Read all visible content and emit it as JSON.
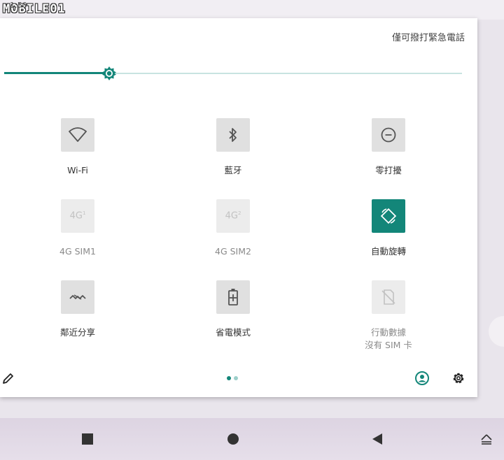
{
  "watermark": {
    "text": "MOBILE01",
    "clock_fragment": "1:50"
  },
  "panel": {
    "emergency_text": "僅可撥打緊急電話",
    "brightness": {
      "level": 0.23
    },
    "tiles": [
      {
        "label": "Wi-Fi",
        "icon": "wifi-icon",
        "state": "inactive"
      },
      {
        "label": "藍牙",
        "icon": "bluetooth-icon",
        "state": "inactive"
      },
      {
        "label": "零打擾",
        "icon": "do-not-disturb-icon",
        "state": "inactive"
      },
      {
        "label": "4G SIM1",
        "icon": "4g-sim1-icon",
        "glyph": "4G",
        "sup": "1",
        "state": "disabled"
      },
      {
        "label": "4G SIM2",
        "icon": "4g-sim2-icon",
        "glyph": "4G",
        "sup": "2",
        "state": "disabled"
      },
      {
        "label": "自動旋轉",
        "icon": "auto-rotate-icon",
        "state": "active"
      },
      {
        "label": "鄰近分享",
        "icon": "nearby-share-icon",
        "state": "inactive"
      },
      {
        "label": "省電模式",
        "icon": "battery-saver-icon",
        "state": "inactive"
      },
      {
        "label": "行動數據",
        "sublabel": "沒有 SIM 卡",
        "icon": "no-sim-icon",
        "state": "disabled"
      }
    ],
    "page_indicator": {
      "pages": 2,
      "current": 1
    }
  },
  "colors": {
    "accent": "#138679",
    "tile_bg": "#e0e0e0",
    "panel_bg": "#ffffff",
    "nav_bg": "#ddd4e2"
  }
}
